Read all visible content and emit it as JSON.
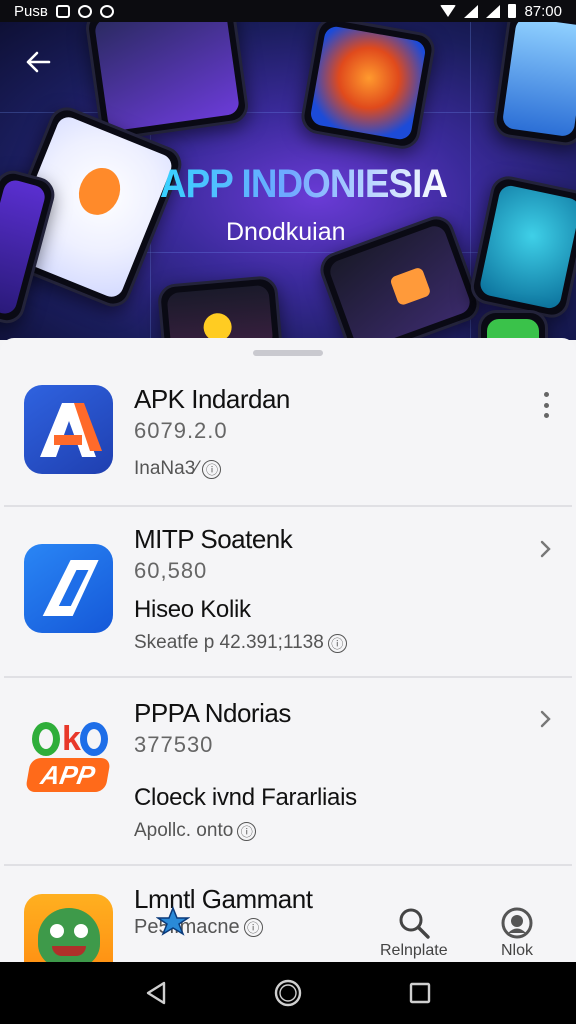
{
  "status_bar": {
    "left_text": "Pusв",
    "time": "87:00"
  },
  "hero": {
    "title": "APP INDONIESIA",
    "subtitle": "Dnodkuian"
  },
  "apps": [
    {
      "title": "APK Indardan",
      "version": "6079.2.0",
      "meta": "InaNa3⁄",
      "action_icon": "more-vert-icon"
    },
    {
      "title": "MITP Soatenk",
      "version": "60,580",
      "subtitle": "Hiseo Kolik",
      "meta": "Skeatfe p 42.391;1138",
      "action_icon": "chevron-right-icon"
    },
    {
      "title": "PPPA Ndorias",
      "version": "377530",
      "subtitle": "Cloeck ivnd Fararliais",
      "meta": "Apollc. onto",
      "icon_text": "APP",
      "action_icon": "chevron-right-icon"
    },
    {
      "title": "Lmntl Gammant",
      "version": "Pe5lfmacne"
    }
  ],
  "info_glyph": "ⓘ",
  "tabs": [
    {
      "label": "Relnplate",
      "icon": "search-icon"
    },
    {
      "label": "Nlok",
      "icon": "profile-icon"
    }
  ],
  "colors": {
    "sheet_bg": "#f5f5f7",
    "hero_accent": "#37d2ff",
    "app1_bg": "#2450c8",
    "app2_bg": "#1e6ee8"
  }
}
